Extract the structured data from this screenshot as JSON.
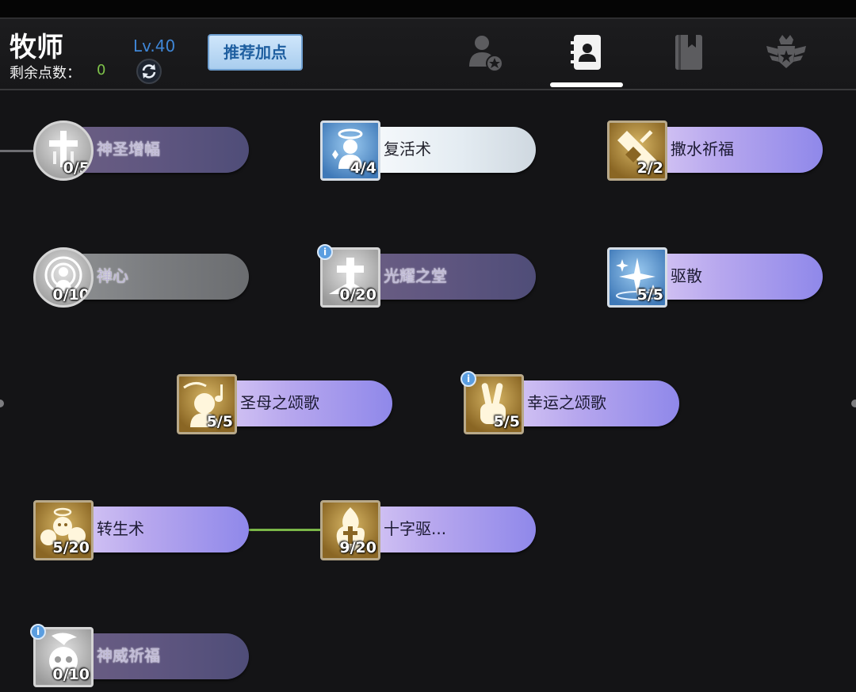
{
  "header": {
    "class_name": "牧师",
    "points_label": "剩余点数：",
    "points_value": "0",
    "level": "Lv.40",
    "recommend_button": "推荐加点"
  },
  "tabs": [
    {
      "icon": "character-star-icon",
      "active": false
    },
    {
      "icon": "contacts-book-icon",
      "active": true
    },
    {
      "icon": "bookmark-book-icon",
      "active": false
    },
    {
      "icon": "winged-crown-badge-icon",
      "active": false
    }
  ],
  "colors": {
    "accent_blue": "#3f86d6",
    "points_green": "#7ec24a",
    "link_line_green": "#7ab648",
    "button_blue": "#a9cdee"
  },
  "skills": {
    "s1": {
      "name": "神圣增幅",
      "count": "0/5",
      "state": "locked",
      "icon": "holy-cross-icon"
    },
    "s2": {
      "name": "复活术",
      "count": "4/4",
      "state": "maxed",
      "icon": "angel-revive-icon"
    },
    "s3": {
      "name": "撒水祈福",
      "count": "2/2",
      "state": "maxed",
      "icon": "water-sprinkle-icon"
    },
    "s4": {
      "name": "禅心",
      "count": "0/10",
      "state": "locked",
      "icon": "zen-mind-icon"
    },
    "s5": {
      "name": "光耀之堂",
      "count": "0/20",
      "state": "locked",
      "icon": "radiant-hall-icon"
    },
    "s6": {
      "name": "驱散",
      "count": "5/5",
      "state": "maxed",
      "icon": "dispel-sparkle-icon"
    },
    "s7": {
      "name": "圣母之颂歌",
      "count": "5/5",
      "state": "maxed",
      "icon": "hymn-music-icon"
    },
    "s8": {
      "name": "幸运之颂歌",
      "count": "5/5",
      "state": "maxed",
      "icon": "lucky-victory-hand-icon"
    },
    "s9": {
      "name": "转生术",
      "count": "5/20",
      "state": "learned",
      "icon": "reincarnation-spirits-icon"
    },
    "s10": {
      "name": "十字驱...",
      "count": "9/20",
      "state": "learned",
      "icon": "cross-flame-icon"
    },
    "s11": {
      "name": "神威祈福",
      "count": "0/10",
      "state": "locked",
      "icon": "divine-skull-icon"
    }
  }
}
